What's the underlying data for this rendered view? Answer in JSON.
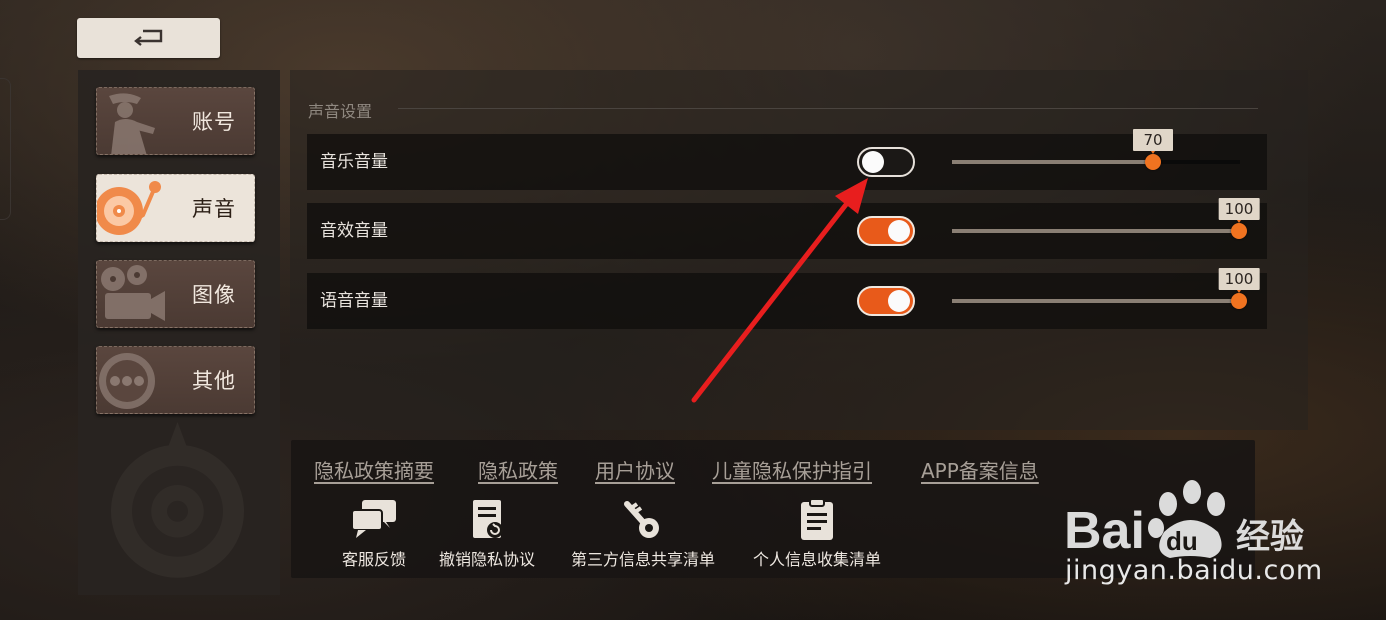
{
  "back": {
    "icon": "back-arrow-icon"
  },
  "sidebar": {
    "items": [
      {
        "label": "账号",
        "icon": "agent-silhouette-icon",
        "active": false
      },
      {
        "label": "声音",
        "icon": "turntable-icon",
        "active": true
      },
      {
        "label": "图像",
        "icon": "film-camera-icon",
        "active": false
      },
      {
        "label": "其他",
        "icon": "more-dots-icon",
        "active": false
      }
    ]
  },
  "sound": {
    "section_title": "声音设置",
    "rows": [
      {
        "label": "音乐音量",
        "enabled": false,
        "volume": 70,
        "volume_text": "70"
      },
      {
        "label": "音效音量",
        "enabled": true,
        "volume": 100,
        "volume_text": "100"
      },
      {
        "label": "语音音量",
        "enabled": true,
        "volume": 100,
        "volume_text": "100"
      }
    ]
  },
  "footer": {
    "links": [
      "隐私政策摘要",
      "隐私政策",
      "用户协议",
      "儿童隐私保护指引",
      "APP备案信息"
    ],
    "actions": [
      {
        "label": "客服反馈",
        "icon": "chat-bubbles-icon"
      },
      {
        "label": "撤销隐私协议",
        "icon": "document-revoke-icon"
      },
      {
        "label": "第三方信息共享清单",
        "icon": "key-icon"
      },
      {
        "label": "个人信息收集清单",
        "icon": "clipboard-icon"
      }
    ]
  },
  "watermark": {
    "brand": "Bai du 经验",
    "url": "jingyan.baidu.com"
  },
  "colors": {
    "accent": "#e85a1a",
    "active_tab": "#ece4da",
    "panel": "#2a2521"
  }
}
